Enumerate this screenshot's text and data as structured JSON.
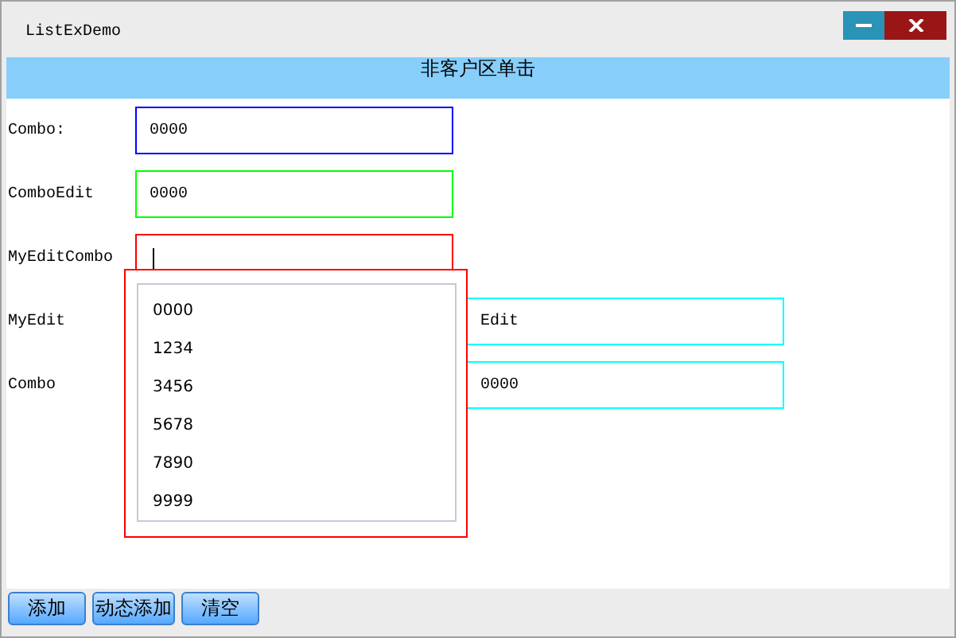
{
  "window": {
    "title": "ListExDemo"
  },
  "banner": "非客户区单击",
  "rows": [
    {
      "label": "Combo:",
      "field": {
        "value": "0000",
        "color": "#0000ff",
        "focused": false
      }
    },
    {
      "label": "ComboEdit",
      "field": {
        "value": "0000",
        "color": "#00ff00",
        "focused": false
      }
    },
    {
      "label": "MyEditCombo",
      "field": {
        "color": "#ff0000",
        "focused": true
      }
    },
    {
      "label": "MyEdit",
      "side_field": {
        "value": "Edit",
        "color": "#00ffff"
      }
    },
    {
      "label": "Combo",
      "side_field": {
        "value": "0000",
        "color": "#00ffff"
      }
    }
  ],
  "dropdown": {
    "items": [
      "0000",
      "1234",
      "3456",
      "5678",
      "7890",
      "9999"
    ]
  },
  "buttons": [
    "添加",
    "动态添加",
    "清空"
  ]
}
